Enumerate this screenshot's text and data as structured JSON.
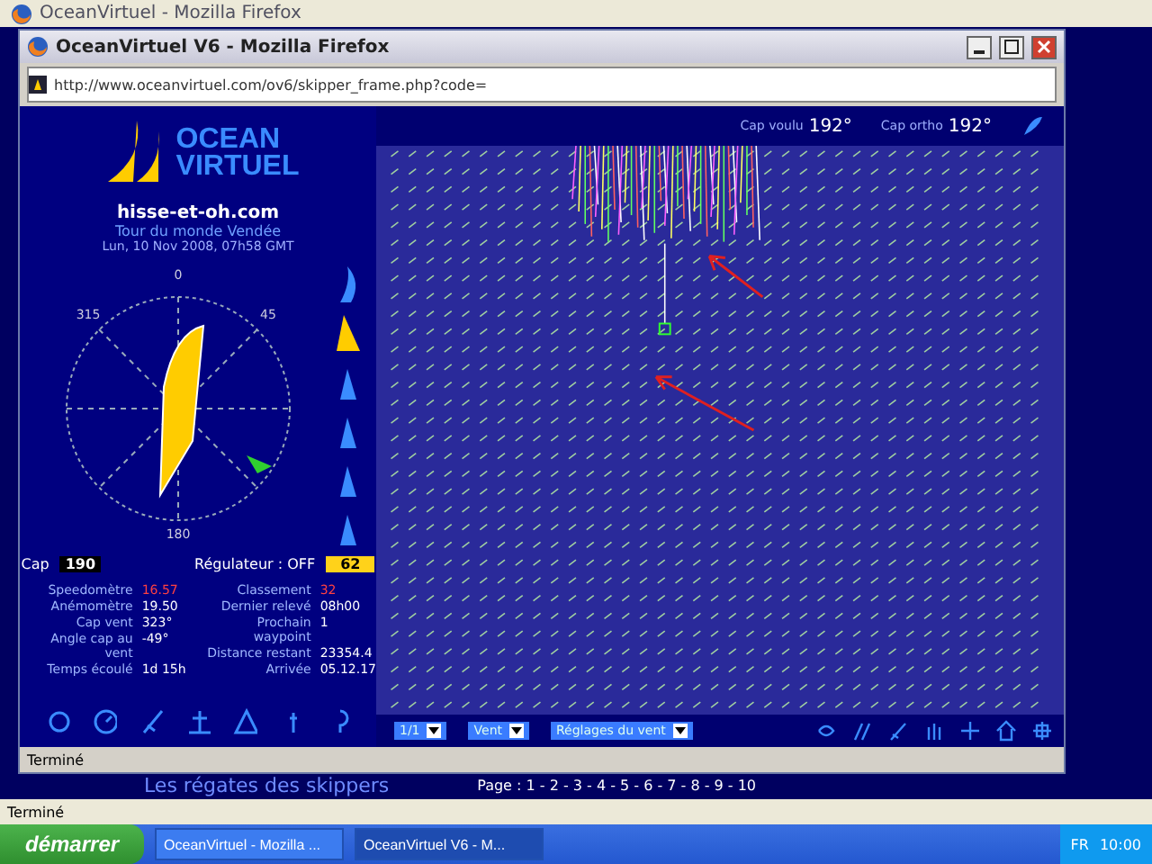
{
  "outer_window": {
    "title": "OceanVirtuel - Mozilla Firefox",
    "background_page": {
      "link": "Les régates des skippers",
      "pages": "Page : 1 - 2 - 3 - 4 - 5 - 6 - 7 - 8 - 9 - 10"
    },
    "status": "Terminé"
  },
  "popup_window": {
    "title": "OceanVirtuel V6 - Mozilla Firefox",
    "url": "http://www.oceanvirtuel.com/ov6/skipper_frame.php?code=",
    "status": "Terminé"
  },
  "logo": {
    "line_1": "OCEAN",
    "line_2": "VIRTUEL"
  },
  "skipper": {
    "site": "hisse-et-oh.com",
    "race": "Tour du monde Vendée",
    "date": "Lun, 10 Nov 2008, 07h58 GMT"
  },
  "compass": {
    "labels": [
      "0",
      "45",
      "315",
      "180"
    ]
  },
  "sails": [
    {
      "kind": "spi",
      "selected": false
    },
    {
      "kind": "genoa",
      "selected": true
    },
    {
      "kind": "jib",
      "selected": false
    },
    {
      "kind": "jib",
      "selected": false
    },
    {
      "kind": "jib",
      "selected": false
    },
    {
      "kind": "jib",
      "selected": false
    }
  ],
  "heading": {
    "label": "Cap",
    "value": "190"
  },
  "autopilot": {
    "label": "Régulateur : OFF",
    "value": "62"
  },
  "stats_left": [
    {
      "label": "Speedomètre",
      "value": "16.57",
      "alert": true
    },
    {
      "label": "Anémomètre",
      "value": "19.50",
      "alert": false
    },
    {
      "label": "Cap vent",
      "value": "323°",
      "alert": false
    },
    {
      "label": "Angle cap au vent",
      "value": "-49°",
      "alert": false
    },
    {
      "label": "Temps écoulé",
      "value": "1d 15h",
      "alert": false
    }
  ],
  "stats_right": [
    {
      "label": "Classement",
      "value": "32",
      "alert": true
    },
    {
      "label": "Dernier relevé",
      "value": "08h00",
      "alert": false
    },
    {
      "label": "Prochain waypoint",
      "value": "1",
      "alert": false
    },
    {
      "label": "Distance restant",
      "value": "23354.4",
      "alert": false
    },
    {
      "label": "Arrivée",
      "value": "05.12.17",
      "alert": false
    }
  ],
  "top_bar": [
    {
      "label": "Cap voulu",
      "value": "192°"
    },
    {
      "label": "Cap ortho",
      "value": "192°"
    }
  ],
  "map_selects": [
    "1/1",
    "Vent",
    "Réglages du vent"
  ],
  "taskbar": {
    "start": "démarrer",
    "tasks": [
      {
        "label": "OceanVirtuel - Mozilla ...",
        "selected": false
      },
      {
        "label": "OceanVirtuel V6 - M...",
        "selected": true
      }
    ],
    "lang": "FR",
    "clock": "10:00"
  }
}
